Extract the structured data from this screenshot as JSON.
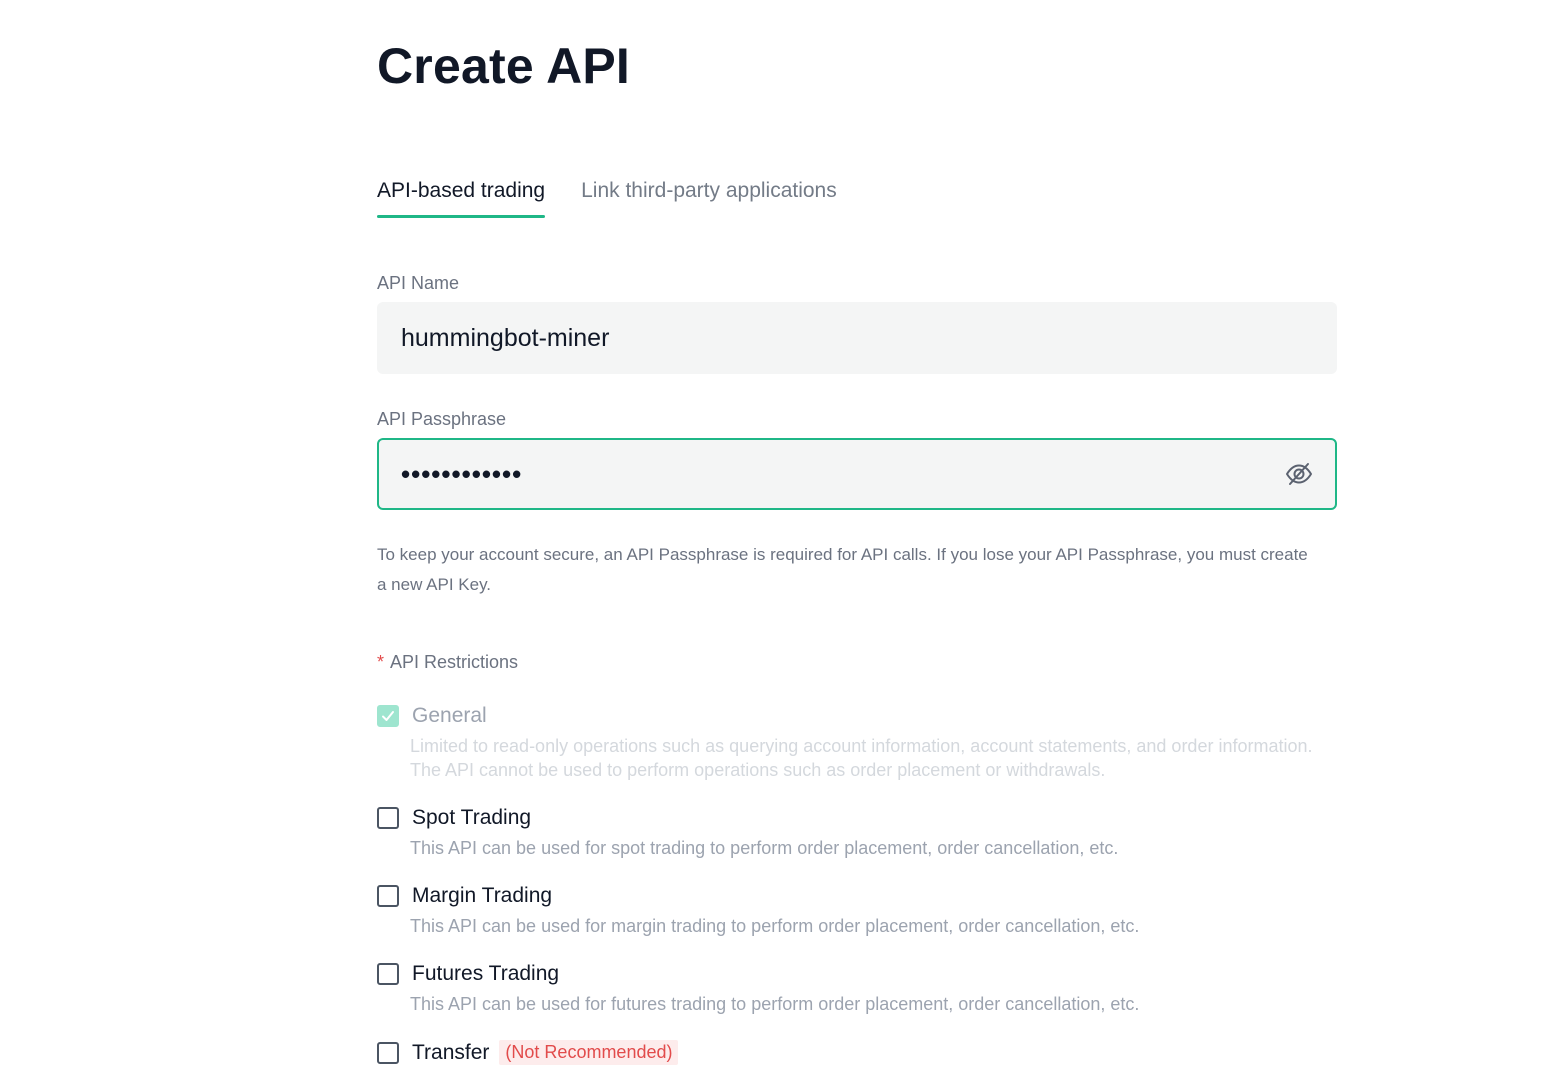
{
  "page": {
    "title": "Create API"
  },
  "tabs": [
    {
      "label": "API-based trading",
      "active": true
    },
    {
      "label": "Link third-party applications",
      "active": false
    }
  ],
  "form": {
    "api_name_label": "API Name",
    "api_name_value": "hummingbot-miner",
    "passphrase_label": "API Passphrase",
    "passphrase_masked": "••••••••••••",
    "passphrase_hint": "To keep your account secure, an API Passphrase is required for API calls. If you lose your API Passphrase, you must create a new API Key."
  },
  "restrictions": {
    "label": "API Restrictions",
    "required_mark": "*",
    "options": [
      {
        "title": "General",
        "checked": true,
        "disabled": true,
        "description": "Limited to read-only operations such as querying account information, account statements, and order information. The API cannot be used to perform operations such as order placement or withdrawals."
      },
      {
        "title": "Spot Trading",
        "checked": false,
        "disabled": false,
        "description": "This API can be used for spot trading to perform order placement, order cancellation, etc."
      },
      {
        "title": "Margin Trading",
        "checked": false,
        "disabled": false,
        "description": "This API can be used for margin trading to perform order placement, order cancellation, etc."
      },
      {
        "title": "Futures Trading",
        "checked": false,
        "disabled": false,
        "description": "This API can be used for futures trading to perform order placement, order cancellation, etc."
      },
      {
        "title": "Transfer",
        "checked": false,
        "disabled": false,
        "badge": "(Not Recommended)"
      }
    ]
  },
  "colors": {
    "accent": "#1fb787",
    "warning": "#e24b4b"
  },
  "icons": {
    "passphrase_toggle": "eye-off-icon",
    "check": "checkmark-icon"
  }
}
